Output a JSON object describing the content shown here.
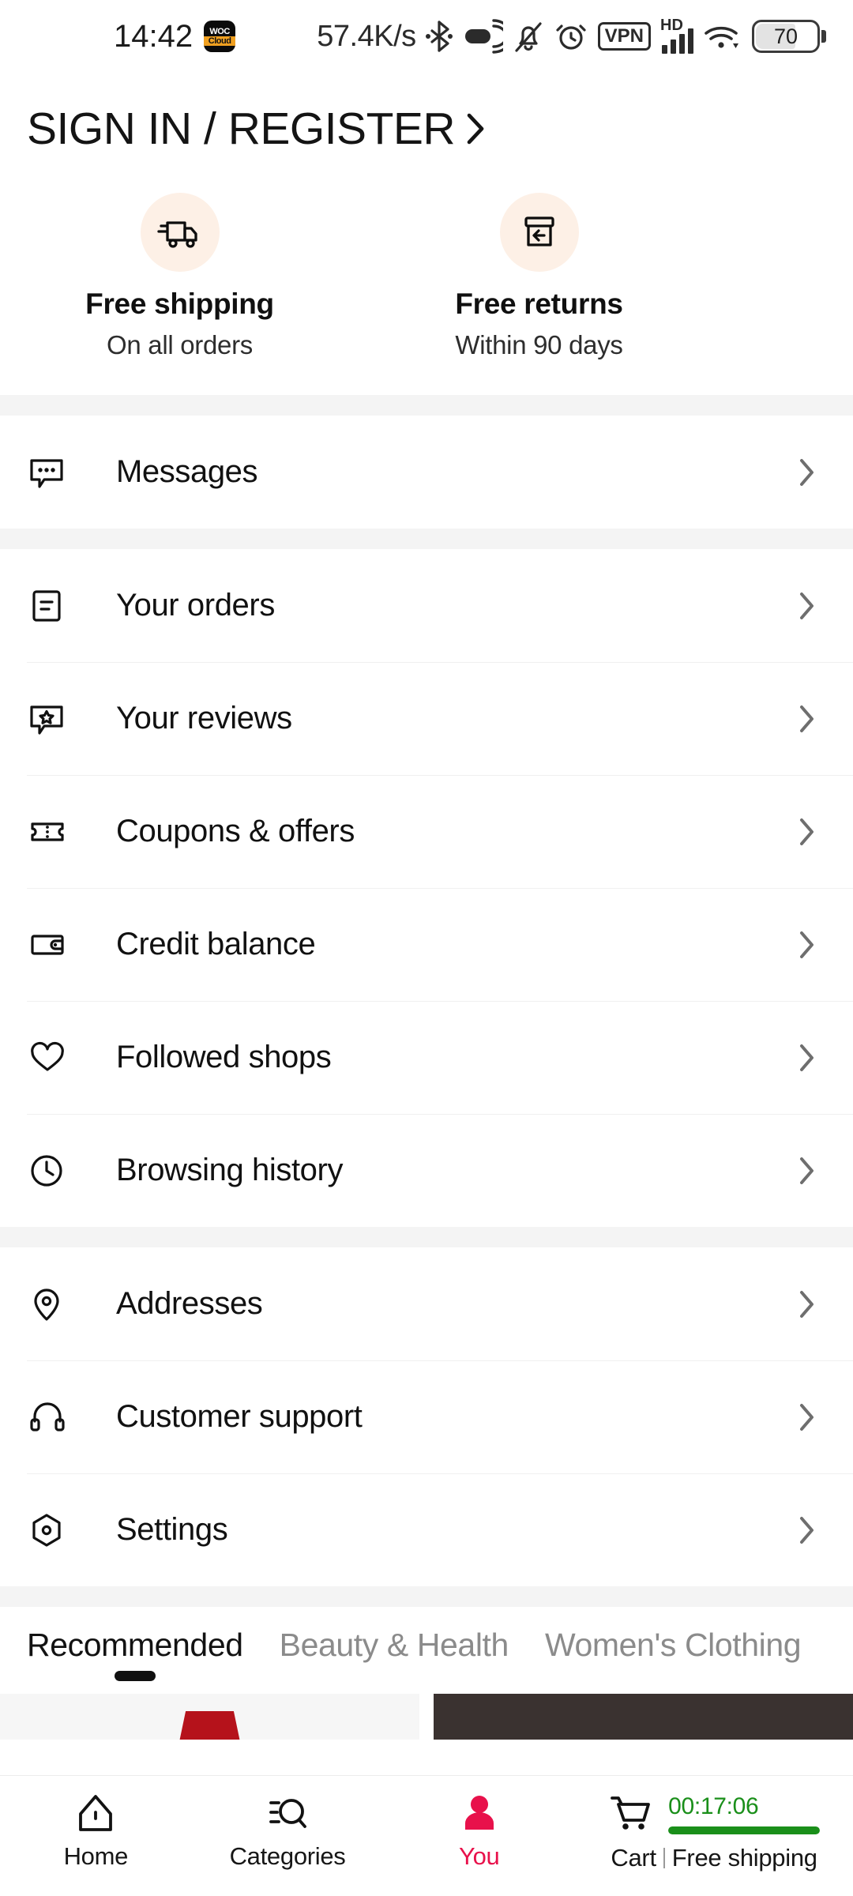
{
  "status_bar": {
    "clock": "14:42",
    "app_badge": {
      "line1": "WOC",
      "line2": "Cloud"
    },
    "network_speed": "57.4K/s",
    "vpn_label": "VPN",
    "hd_label": "HD",
    "battery_percent": "70",
    "icons": [
      "bluetooth-icon",
      "nfc-icon",
      "mute-bell-icon",
      "alarm-icon",
      "vpn-icon",
      "hd-signal-icon",
      "wifi-icon",
      "battery-icon"
    ]
  },
  "header": {
    "signin_label": "SIGN IN / REGISTER",
    "chevron": "chevron-right-icon"
  },
  "benefits": [
    {
      "icon": "delivery-truck-icon",
      "title": "Free shipping",
      "subtitle": "On all orders",
      "circle_color": "#fdf0e6"
    },
    {
      "icon": "return-box-icon",
      "title": "Free returns",
      "subtitle": "Within 90 days",
      "circle_color": "#fdf0e6"
    }
  ],
  "menu_groups": [
    {
      "items": [
        {
          "icon": "message-bubble-icon",
          "label": "Messages"
        }
      ]
    },
    {
      "items": [
        {
          "icon": "order-receipt-icon",
          "label": "Your orders"
        },
        {
          "icon": "review-star-bubble-icon",
          "label": "Your reviews"
        },
        {
          "icon": "coupon-ticket-icon",
          "label": "Coupons & offers"
        },
        {
          "icon": "wallet-card-icon",
          "label": "Credit balance"
        },
        {
          "icon": "heart-icon",
          "label": "Followed shops"
        },
        {
          "icon": "clock-history-icon",
          "label": "Browsing history"
        }
      ]
    },
    {
      "items": [
        {
          "icon": "location-pin-icon",
          "label": "Addresses"
        },
        {
          "icon": "headset-icon",
          "label": "Customer support"
        },
        {
          "icon": "settings-hex-icon",
          "label": "Settings"
        }
      ]
    }
  ],
  "tabs": [
    {
      "label": "Recommended",
      "active": true
    },
    {
      "label": "Beauty & Health",
      "active": false
    },
    {
      "label": "Women's Clothing",
      "active": false
    }
  ],
  "bottom_nav": {
    "items": [
      {
        "icon": "home-icon",
        "label": "Home",
        "active": false
      },
      {
        "icon": "categories-search-icon",
        "label": "Categories",
        "active": false
      },
      {
        "icon": "person-icon",
        "label": "You",
        "active": true
      }
    ],
    "cart": {
      "icon": "shopping-cart-icon",
      "timer": "00:17:06",
      "progress_percent": 100,
      "label": "Cart",
      "shipping_label": "Free shipping",
      "timer_color": "#1a8f1a"
    }
  },
  "colors": {
    "accent": "#e8114b",
    "timer_green": "#1a8f1a",
    "benefit_circle": "#fdf0e6",
    "divider": "#f0f0f0",
    "section_gap": "#f4f4f4",
    "muted_text": "#8b8b8b"
  }
}
